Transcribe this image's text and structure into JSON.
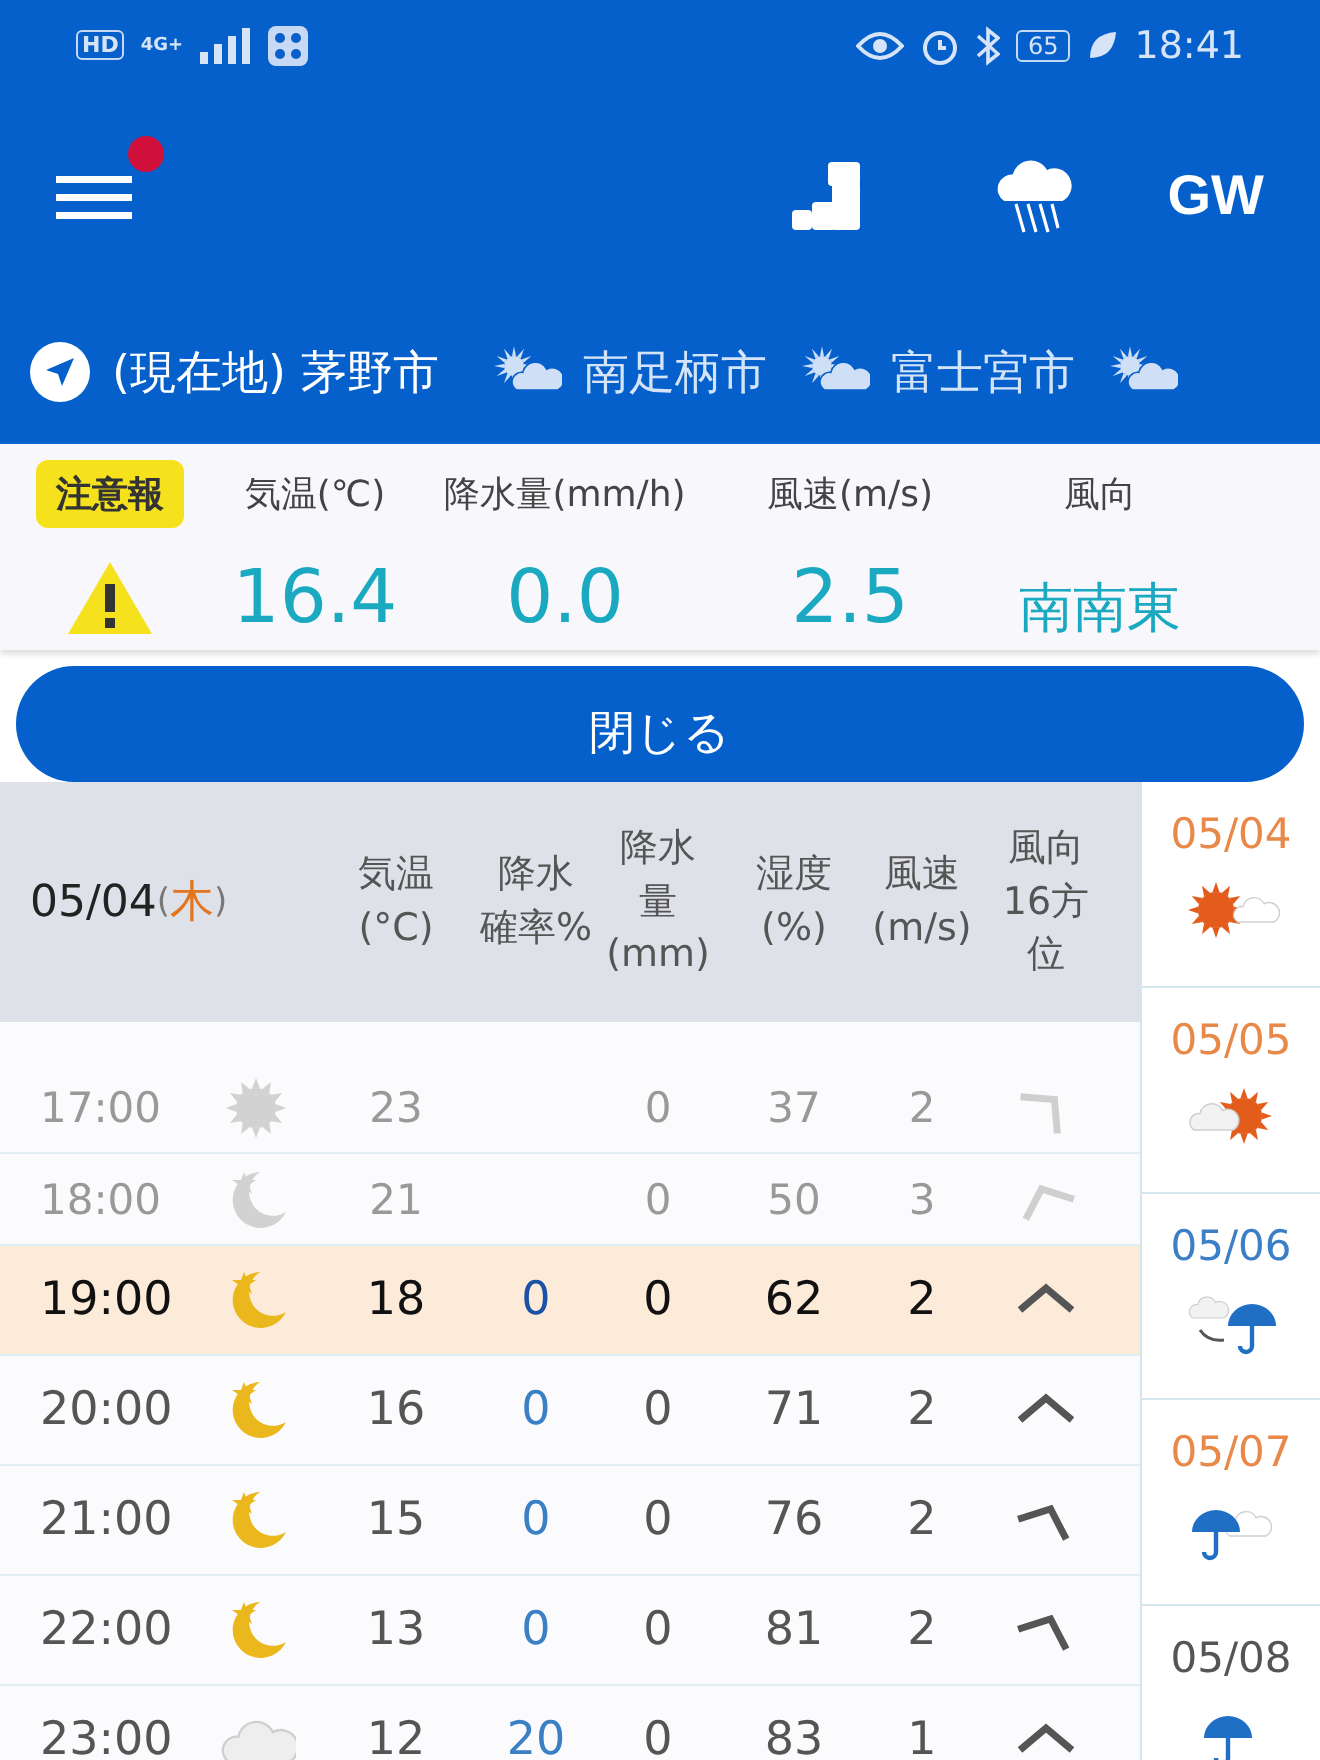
{
  "status_bar": {
    "left_texts": [
      "HD",
      "4G+"
    ],
    "battery": "65",
    "time": "18:41"
  },
  "app_bar": {
    "notification_dot": true,
    "gw_label": "GW"
  },
  "locations": [
    {
      "name": "(現在地) 茅野市",
      "kind": "current"
    },
    {
      "name": "南足柄市",
      "kind": "weather"
    },
    {
      "name": "富士宮市",
      "kind": "weather"
    }
  ],
  "current": {
    "alert": "注意報",
    "labels": [
      "気温(℃)",
      "降水量(mm/h)",
      "風速(m/s)",
      "風向"
    ],
    "values": [
      "16.4",
      "0.0",
      "2.5",
      "南南東"
    ]
  },
  "close_button": "閉じる",
  "table": {
    "date": "05/04",
    "weekday_parts": [
      "(",
      "木",
      ")"
    ],
    "columns": [
      {
        "lines": [
          "気温",
          "(°C)"
        ]
      },
      {
        "lines": [
          "降水",
          "確率%"
        ]
      },
      {
        "lines": [
          "降水",
          "量",
          "(mm)"
        ]
      },
      {
        "lines": [
          "湿度",
          "(%)"
        ]
      },
      {
        "lines": [
          "風速",
          "(m/s)"
        ]
      },
      {
        "lines": [
          "風向",
          "16方",
          "位"
        ]
      }
    ],
    "rows": [
      {
        "time": "17:00",
        "kind": "sun",
        "temp": "23",
        "amount": "0",
        "humidity": "37",
        "speed": "2",
        "wind": {
          "kind": "ne"
        },
        "past": true,
        "selected": false
      },
      {
        "time": "18:00",
        "kind": "moon",
        "temp": "21",
        "amount": "0",
        "humidity": "50",
        "speed": "3",
        "wind": {
          "kind": "nnw"
        },
        "past": true,
        "selected": false
      },
      {
        "time": "19:00",
        "kind": "moon",
        "temp": "18",
        "prob": "0",
        "amount": "0",
        "humidity": "62",
        "speed": "2",
        "wind": {
          "kind": "n"
        },
        "past": false,
        "selected": true
      },
      {
        "time": "20:00",
        "kind": "moon",
        "temp": "16",
        "prob": "0",
        "amount": "0",
        "humidity": "71",
        "speed": "2",
        "wind": {
          "kind": "n"
        },
        "past": false,
        "selected": false
      },
      {
        "time": "21:00",
        "kind": "moon",
        "temp": "15",
        "prob": "0",
        "amount": "0",
        "humidity": "76",
        "speed": "2",
        "wind": {
          "kind": "nne"
        },
        "past": false,
        "selected": false
      },
      {
        "time": "22:00",
        "kind": "moon",
        "temp": "13",
        "prob": "0",
        "amount": "0",
        "humidity": "81",
        "speed": "2",
        "wind": {
          "kind": "nne"
        },
        "past": false,
        "selected": false
      },
      {
        "time": "23:00",
        "kind": "cloud",
        "temp": "12",
        "prob": "20",
        "amount": "0",
        "humidity": "83",
        "speed": "1",
        "wind": {
          "kind": "n"
        },
        "past": false,
        "selected": false
      }
    ]
  },
  "days": [
    {
      "date": "05/04",
      "color": "#e8894a",
      "kind": "sun_cloud"
    },
    {
      "date": "05/05",
      "color": "#e8894a",
      "kind": "cloud_sun"
    },
    {
      "date": "05/06",
      "color": "#3d7fc6",
      "kind": "cloud_to_rain"
    },
    {
      "date": "05/07",
      "color": "#e8894a",
      "kind": "rain_cloud"
    },
    {
      "date": "05/08",
      "color": "#555555",
      "kind": "rain"
    }
  ]
}
